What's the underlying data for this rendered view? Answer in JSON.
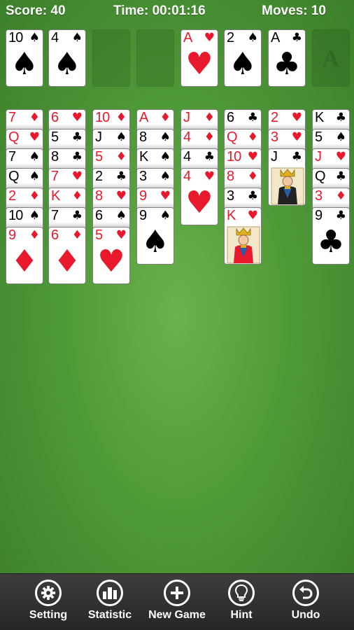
{
  "hud": {
    "score": "Score: 40",
    "time": "Time: 00:01:16",
    "moves": "Moves: 10"
  },
  "free_cells": [
    {
      "rank": "10",
      "suit": "♠",
      "color": "black"
    },
    {
      "rank": "4",
      "suit": "♠",
      "color": "black"
    },
    null,
    null
  ],
  "foundations": [
    {
      "rank": "A",
      "suit": "♥",
      "color": "red"
    },
    {
      "rank": "2",
      "suit": "♠",
      "color": "black"
    },
    {
      "rank": "A",
      "suit": "♣",
      "color": "black"
    },
    {
      "empty_label": "A"
    }
  ],
  "tableau": [
    [
      {
        "rank": "7",
        "suit": "♦",
        "color": "red"
      },
      {
        "rank": "Q",
        "suit": "♥",
        "color": "red"
      },
      {
        "rank": "7",
        "suit": "♠",
        "color": "black"
      },
      {
        "rank": "Q",
        "suit": "♠",
        "color": "black"
      },
      {
        "rank": "2",
        "suit": "♦",
        "color": "red"
      },
      {
        "rank": "10",
        "suit": "♠",
        "color": "black"
      },
      {
        "rank": "9",
        "suit": "♦",
        "color": "red"
      }
    ],
    [
      {
        "rank": "6",
        "suit": "♥",
        "color": "red"
      },
      {
        "rank": "5",
        "suit": "♣",
        "color": "black"
      },
      {
        "rank": "8",
        "suit": "♣",
        "color": "black"
      },
      {
        "rank": "7",
        "suit": "♥",
        "color": "red"
      },
      {
        "rank": "K",
        "suit": "♦",
        "color": "red"
      },
      {
        "rank": "7",
        "suit": "♣",
        "color": "black"
      },
      {
        "rank": "6",
        "suit": "♦",
        "color": "red"
      }
    ],
    [
      {
        "rank": "10",
        "suit": "♦",
        "color": "red"
      },
      {
        "rank": "J",
        "suit": "♠",
        "color": "black"
      },
      {
        "rank": "5",
        "suit": "♦",
        "color": "red"
      },
      {
        "rank": "2",
        "suit": "♣",
        "color": "black"
      },
      {
        "rank": "8",
        "suit": "♥",
        "color": "red"
      },
      {
        "rank": "6",
        "suit": "♠",
        "color": "black"
      },
      {
        "rank": "5",
        "suit": "♥",
        "color": "red"
      }
    ],
    [
      {
        "rank": "A",
        "suit": "♦",
        "color": "red"
      },
      {
        "rank": "8",
        "suit": "♠",
        "color": "black"
      },
      {
        "rank": "K",
        "suit": "♠",
        "color": "black"
      },
      {
        "rank": "3",
        "suit": "♠",
        "color": "black"
      },
      {
        "rank": "9",
        "suit": "♥",
        "color": "red"
      },
      {
        "rank": "9",
        "suit": "♠",
        "color": "black"
      }
    ],
    [
      {
        "rank": "J",
        "suit": "♦",
        "color": "red"
      },
      {
        "rank": "4",
        "suit": "♦",
        "color": "red"
      },
      {
        "rank": "4",
        "suit": "♣",
        "color": "black"
      },
      {
        "rank": "4",
        "suit": "♥",
        "color": "red"
      }
    ],
    [
      {
        "rank": "6",
        "suit": "♣",
        "color": "black"
      },
      {
        "rank": "Q",
        "suit": "♦",
        "color": "red"
      },
      {
        "rank": "10",
        "suit": "♥",
        "color": "red"
      },
      {
        "rank": "8",
        "suit": "♦",
        "color": "red"
      },
      {
        "rank": "3",
        "suit": "♣",
        "color": "black"
      },
      {
        "rank": "K",
        "suit": "♥",
        "color": "red",
        "face": true
      }
    ],
    [
      {
        "rank": "2",
        "suit": "♥",
        "color": "red"
      },
      {
        "rank": "3",
        "suit": "♥",
        "color": "red"
      },
      {
        "rank": "J",
        "suit": "♣",
        "color": "black",
        "face": true
      }
    ],
    [
      {
        "rank": "K",
        "suit": "♣",
        "color": "black"
      },
      {
        "rank": "5",
        "suit": "♠",
        "color": "black"
      },
      {
        "rank": "J",
        "suit": "♥",
        "color": "red"
      },
      {
        "rank": "Q",
        "suit": "♣",
        "color": "black"
      },
      {
        "rank": "3",
        "suit": "♦",
        "color": "red"
      },
      {
        "rank": "9",
        "suit": "♣",
        "color": "black"
      }
    ]
  ],
  "toolbar": [
    {
      "label": "Setting",
      "icon": "gear-icon"
    },
    {
      "label": "Statistic",
      "icon": "bar-chart-icon"
    },
    {
      "label": "New Game",
      "icon": "plus-icon"
    },
    {
      "label": "Hint",
      "icon": "lightbulb-icon"
    },
    {
      "label": "Undo",
      "icon": "undo-arrow-icon"
    }
  ],
  "colors": {
    "red": "#e8192c",
    "black": "#000000",
    "felt": "#4f9a38"
  }
}
